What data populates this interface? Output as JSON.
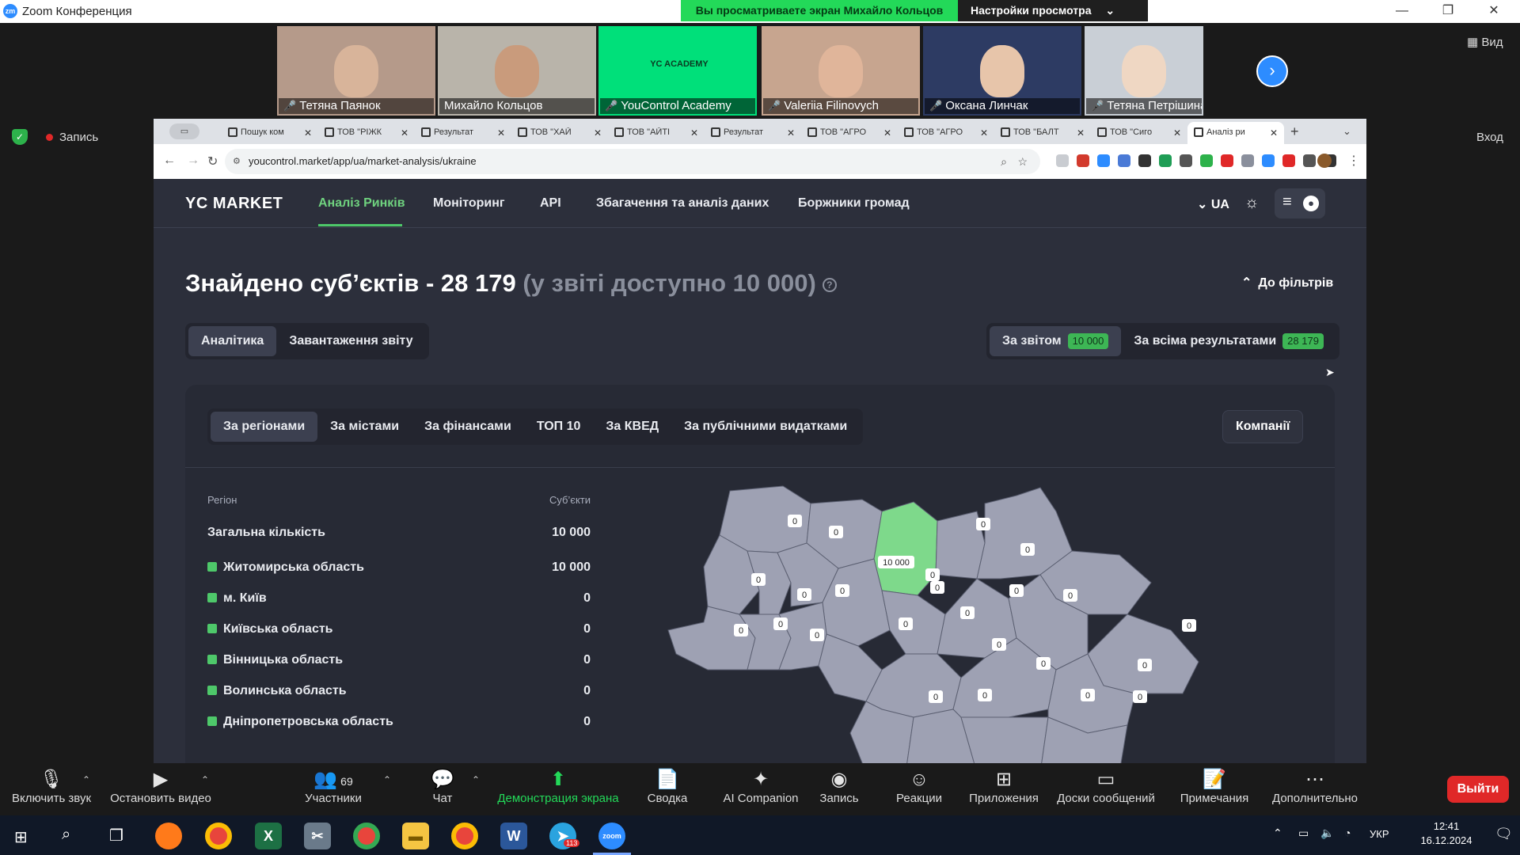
{
  "window": {
    "app_title": "Zoom Конференция",
    "minimize": "—",
    "restore": "❐",
    "close": "✕"
  },
  "share_banner": {
    "viewing": "Вы просматриваете экран Михайло Кольцов",
    "view_settings": "Настройки просмотра",
    "chevron": "⌄"
  },
  "participants": [
    {
      "name": "Тетяна Паянок",
      "muted": true,
      "bg": "#b59a8a",
      "face": "#d8b49a"
    },
    {
      "name": "Михайло Кольцов",
      "muted": false,
      "bg": "#b9b4aa",
      "face": "#c99b7c"
    },
    {
      "name": "YouControl Academy",
      "muted": true,
      "bg": "#00e07a",
      "face": "",
      "logo": "YC ACADEMY"
    },
    {
      "name": "Valeriia Filinovych",
      "muted": true,
      "bg": "#c7a58f",
      "face": "#e0b59a"
    },
    {
      "name": "Оксана Линчак",
      "muted": true,
      "bg": "#2d3b63",
      "face": "#e7c5aa"
    },
    {
      "name": "Тетяна Петрішина",
      "muted": true,
      "bg": "#c9cfd6",
      "face": "#efd7c3"
    }
  ],
  "side": {
    "view": "Вид",
    "record": "Запись",
    "enter": "Вход"
  },
  "browser": {
    "tabs": [
      "Пошук ком",
      "ТОВ \"РІЖК",
      "Результат",
      "ТОВ \"ХАЙ",
      "ТОВ \"АЙТІ",
      "Результат",
      "ТОВ \"АГРО",
      "ТОВ \"АГРО",
      "ТОВ \"БАЛТ",
      "ТОВ \"Сиго",
      "Аналіз ри"
    ],
    "new_tab": "+",
    "url": "youcontrol.market/app/ua/market-analysis/ukraine"
  },
  "nav": {
    "brand": "YC MARKET",
    "items": [
      "Аналіз Ринків",
      "Моніторинг",
      "API",
      "Збагачення та аналіз даних",
      "Боржники громад"
    ],
    "lang": "UA"
  },
  "heading": {
    "main": "Знайдено суб’єктів - 28 179",
    "muted": "(у звіті доступно 10 000)",
    "help": "?",
    "to_filters": "До фільтрів"
  },
  "view_tabs": [
    "Аналітика",
    "Завантаження звіту"
  ],
  "scope": {
    "by_report": "За звітом",
    "by_report_count": "10 000",
    "all_results": "За всіма результатами",
    "all_count": "28 179"
  },
  "analysis_tabs": [
    "За регіонами",
    "За містами",
    "За фінансами",
    "ТОП 10",
    "За КВЕД",
    "За публічними видатками"
  ],
  "companies_button": "Компанії",
  "table": {
    "col_region": "Регіон",
    "col_count": "Суб’єкти",
    "total_label": "Загальна кількість",
    "total_value": "10 000",
    "rows": [
      {
        "region": "Житомирська область",
        "value": "10 000"
      },
      {
        "region": "м. Київ",
        "value": "0"
      },
      {
        "region": "Київська область",
        "value": "0"
      },
      {
        "region": "Вінницька область",
        "value": "0"
      },
      {
        "region": "Волинська область",
        "value": "0"
      },
      {
        "region": "Дніпропетровська область",
        "value": "0"
      }
    ]
  },
  "map": {
    "highlight": "10 000",
    "zero": "0",
    "region_color": "#9ea1b3",
    "highlight_color": "#7ed98b"
  },
  "toolbar": {
    "unmute": "Включить звук",
    "stop_video": "Остановить видео",
    "participants": "Участники",
    "participants_count": "69",
    "chat": "Чат",
    "share": "Демонстрация экрана",
    "summary": "Сводка",
    "ai": "AI Companion",
    "record": "Запись",
    "reactions": "Реакции",
    "apps": "Приложения",
    "whiteboards": "Доски сообщений",
    "notes": "Примечания",
    "more": "Дополнительно",
    "leave": "Выйти"
  },
  "taskbar": {
    "lang": "УКР",
    "time": "12:41",
    "date": "16.12.2024",
    "telegram_badge": "113"
  }
}
